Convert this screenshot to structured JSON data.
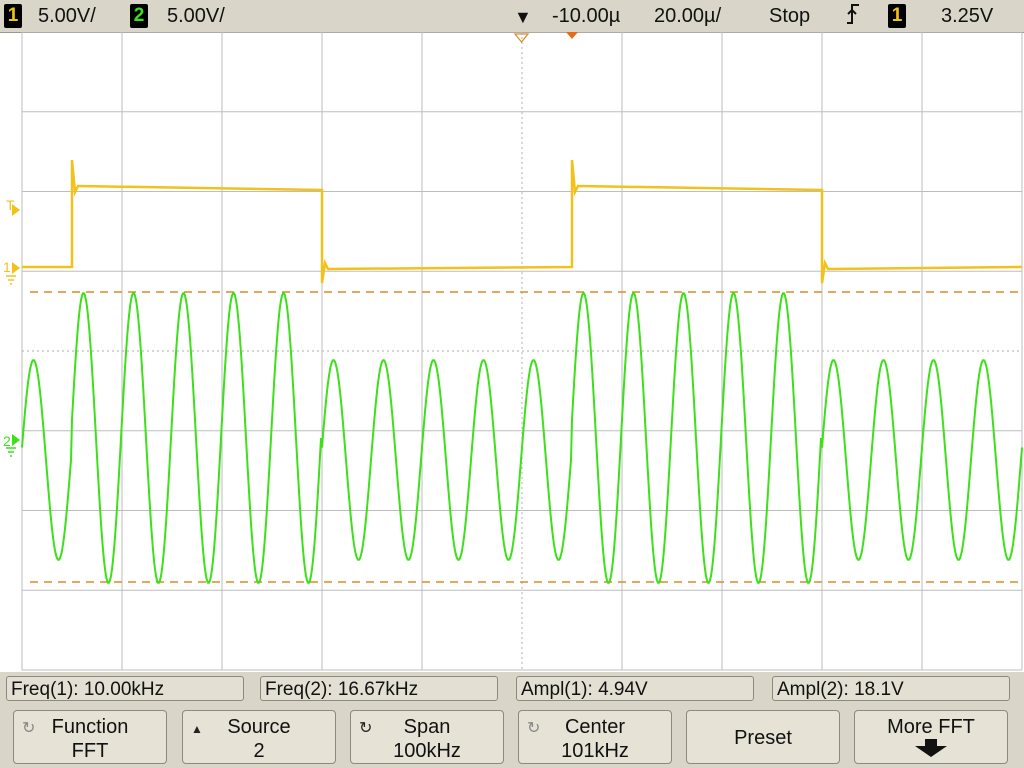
{
  "topbar": {
    "ch1_num": "1",
    "ch1_scale": "5.00V/",
    "ch2_num": "2",
    "ch2_scale": "5.00V/",
    "delay": "-10.00µ",
    "timebase": "20.00µ/",
    "run_state": "Stop",
    "trig_slope_icon": "rising-edge-icon",
    "trig_src_num": "1",
    "trig_level": "3.25V"
  },
  "markers": {
    "ch1": "1",
    "ch2": "2",
    "trig": "T"
  },
  "measurements": [
    {
      "label": "Freq(1): 10.00kHz"
    },
    {
      "label": "Freq(2): 16.67kHz"
    },
    {
      "label": "Ampl(1): 4.94V"
    },
    {
      "label": "Ampl(2): 18.1V"
    }
  ],
  "softkeys": [
    {
      "line1": "Function",
      "line2": "FFT"
    },
    {
      "line1": "Source",
      "line2": "2"
    },
    {
      "line1": "Span",
      "line2": "100kHz"
    },
    {
      "line1": "Center",
      "line2": "101kHz"
    },
    {
      "line1": "Preset",
      "line2": ""
    },
    {
      "line1": "More FFT",
      "line2": ""
    }
  ],
  "colors": {
    "ch1": "#f2c21b",
    "ch2": "#3de01a",
    "cursor": "#d98c2b",
    "grid": "#bdbdbd"
  }
}
